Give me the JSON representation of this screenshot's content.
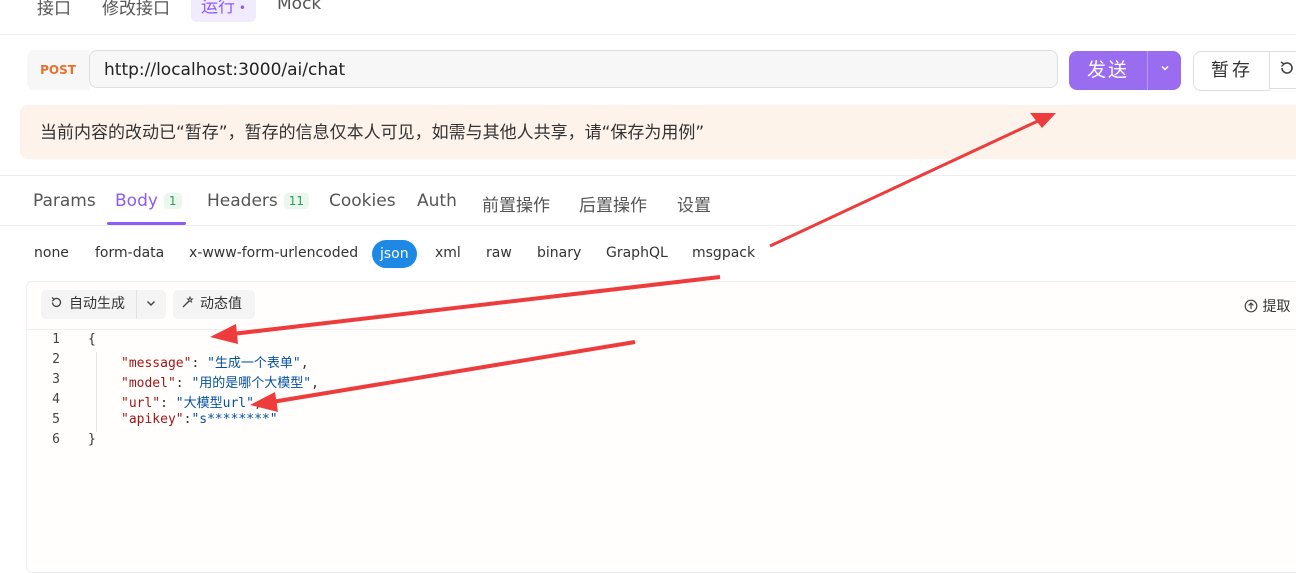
{
  "top_tabs": [
    "接口",
    "修改接口",
    "运行",
    "Mock"
  ],
  "request": {
    "method": "POST",
    "url": "http://localhost:3000/ai/chat",
    "send_label": "发送",
    "send_dropdown_icon": "chevron-down-icon",
    "stash_label": "暂存",
    "more_icon": "refresh-icon"
  },
  "notice": "当前内容的改动已“暂存”，暂存的信息仅本人可见，如需与其他人共享，请“保存为用例”",
  "request_tabs": [
    {
      "label": "Params"
    },
    {
      "label": "Body",
      "count": "1"
    },
    {
      "label": "Headers",
      "count": "11"
    },
    {
      "label": "Cookies"
    },
    {
      "label": "Auth"
    },
    {
      "label": "前置操作"
    },
    {
      "label": "后置操作"
    },
    {
      "label": "设置"
    }
  ],
  "active_tab": "Body",
  "body_types": [
    "none",
    "form-data",
    "x-www-form-urlencoded",
    "json",
    "xml",
    "raw",
    "binary",
    "GraphQL",
    "msgpack"
  ],
  "active_body_type": "json",
  "editor_toolbar": {
    "auto_generate": "自动生成",
    "dynamic_value": "动态值",
    "extract": "提取"
  },
  "code_lines": [
    {
      "num": "1",
      "text": "{"
    },
    {
      "num": "2",
      "key": "\"message\"",
      "sep": ": ",
      "value": "\"生成一个表单\"",
      "end": ","
    },
    {
      "num": "3",
      "key": "\"model\"",
      "sep": ": ",
      "value": "\"用的是哪个大模型\"",
      "end": ","
    },
    {
      "num": "4",
      "key": "\"url\"",
      "sep": ": ",
      "value": "\"大模型url\"",
      "end": ","
    },
    {
      "num": "5",
      "key": "\"apikey\"",
      "sep": ":",
      "value": "\"s********\"",
      "end": ""
    },
    {
      "num": "6",
      "text": "}"
    }
  ],
  "colors": {
    "accent": "#8b5cf6",
    "send_button": "#9a6cf0",
    "method": "#e8702a",
    "json_key": "#a31515",
    "json_string": "#0451a5",
    "notice_bg": "#fdf3eb",
    "annotation_arrow": "#ee3b3b"
  }
}
